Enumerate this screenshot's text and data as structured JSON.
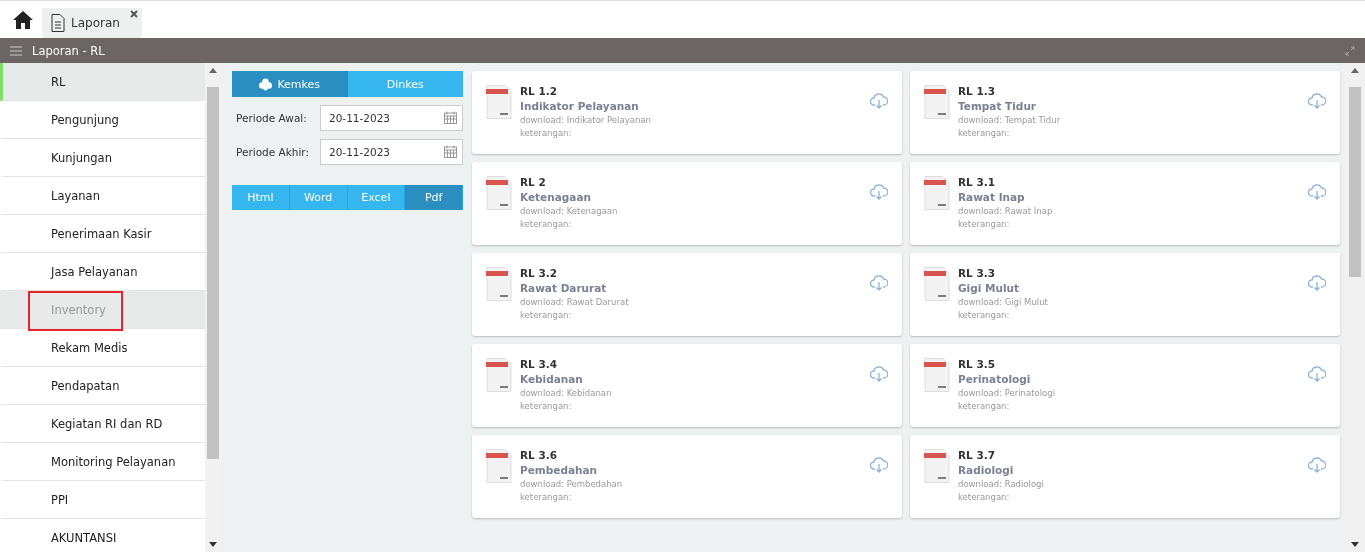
{
  "tabs": [
    {
      "label": "Laporan",
      "selected": true
    }
  ],
  "header": {
    "title": "Laporan - RL"
  },
  "sidebar": {
    "items": [
      {
        "label": "RL",
        "selected": true,
        "hovered": false,
        "annotated": false
      },
      {
        "label": "Pengunjung",
        "selected": false,
        "hovered": false,
        "annotated": false
      },
      {
        "label": "Kunjungan",
        "selected": false,
        "hovered": false,
        "annotated": false
      },
      {
        "label": "Layanan",
        "selected": false,
        "hovered": false,
        "annotated": false
      },
      {
        "label": "Penerimaan Kasir",
        "selected": false,
        "hovered": false,
        "annotated": false
      },
      {
        "label": "Jasa Pelayanan",
        "selected": false,
        "hovered": false,
        "annotated": false
      },
      {
        "label": "Inventory",
        "selected": false,
        "hovered": true,
        "annotated": true
      },
      {
        "label": "Rekam Medis",
        "selected": false,
        "hovered": false,
        "annotated": false
      },
      {
        "label": "Pendapatan",
        "selected": false,
        "hovered": false,
        "annotated": false
      },
      {
        "label": "Kegiatan RI dan RD",
        "selected": false,
        "hovered": false,
        "annotated": false
      },
      {
        "label": "Monitoring Pelayanan",
        "selected": false,
        "hovered": false,
        "annotated": false
      },
      {
        "label": "PPI",
        "selected": false,
        "hovered": false,
        "annotated": false
      },
      {
        "label": "AKUNTANSI",
        "selected": false,
        "hovered": false,
        "annotated": false
      }
    ]
  },
  "filter": {
    "sources": [
      {
        "label": "Kemkes",
        "selected": true
      },
      {
        "label": "Dinkes",
        "selected": false
      }
    ],
    "fields": [
      {
        "label": "Periode Awal:",
        "value": "20-11-2023"
      },
      {
        "label": "Periode Akhir:",
        "value": "20-11-2023"
      }
    ],
    "formats": [
      {
        "label": "Html",
        "selected": false
      },
      {
        "label": "Word",
        "selected": false
      },
      {
        "label": "Excel",
        "selected": false
      },
      {
        "label": "Pdf",
        "selected": true
      }
    ]
  },
  "reports": [
    {
      "code": "RL 1.2",
      "title": "Indikator Pelayanan",
      "download": "download: Indikator Pelayanan",
      "note": "keterangan:"
    },
    {
      "code": "RL 1.3",
      "title": "Tempat Tidur",
      "download": "download: Tempat Tidur",
      "note": "keterangan:"
    },
    {
      "code": "RL 2",
      "title": "Ketenagaan",
      "download": "download: Ketenagaan",
      "note": "keterangan:"
    },
    {
      "code": "RL 3.1",
      "title": "Rawat Inap",
      "download": "download: Rawat Inap",
      "note": "keterangan:"
    },
    {
      "code": "RL 3.2",
      "title": "Rawat Darurat",
      "download": "download: Rawat Darurat",
      "note": "keterangan:"
    },
    {
      "code": "RL 3.3",
      "title": "Gigi Mulut",
      "download": "download: Gigi Mulut",
      "note": "keterangan:"
    },
    {
      "code": "RL 3.4",
      "title": "Kebidanan",
      "download": "download: Kebidanan",
      "note": "keterangan:"
    },
    {
      "code": "RL 3.5",
      "title": "Perinatologi",
      "download": "download: Perinatologi",
      "note": "keterangan:"
    },
    {
      "code": "RL 3.6",
      "title": "Pembedahan",
      "download": "download: Pembedahan",
      "note": "keterangan:"
    },
    {
      "code": "RL 3.7",
      "title": "Radiologi",
      "download": "download: Radiologi",
      "note": "keterangan:"
    }
  ]
}
